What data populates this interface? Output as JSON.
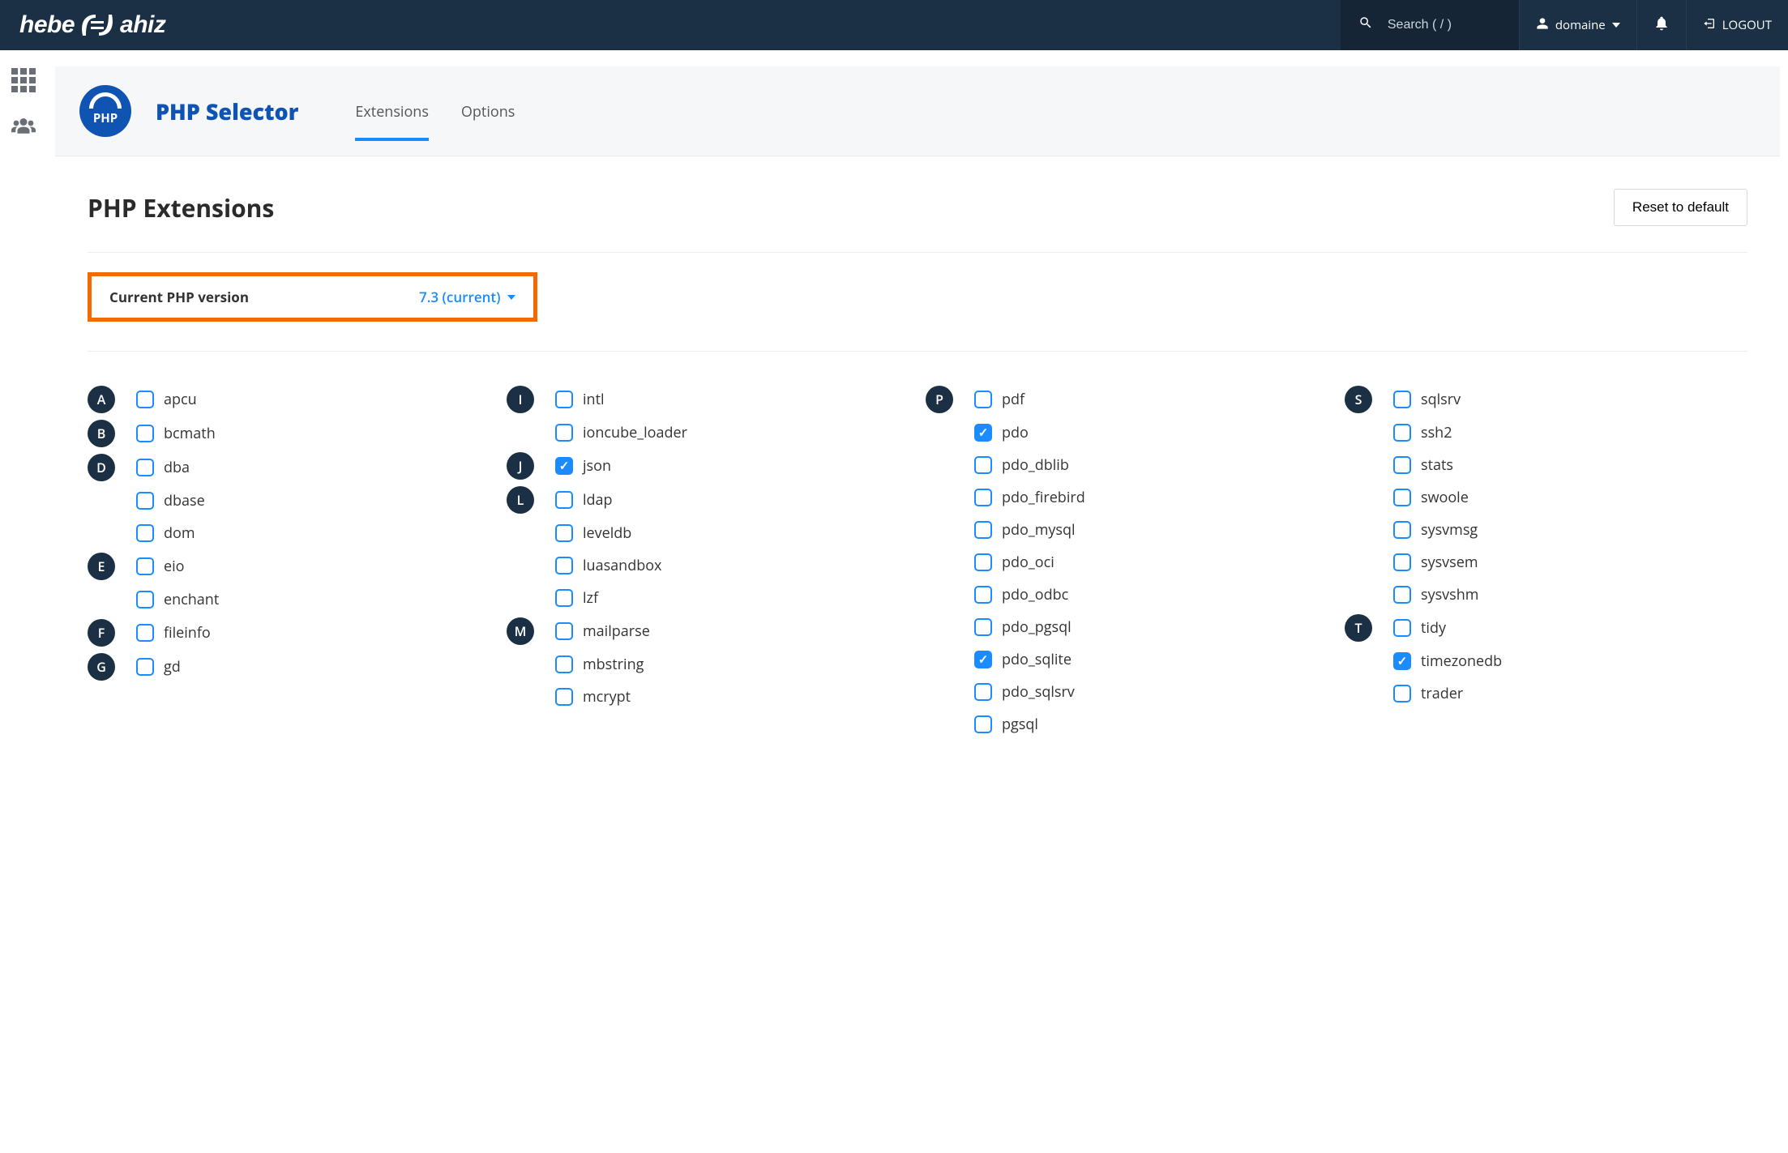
{
  "nav": {
    "brand_left": "hebe",
    "brand_right": "ahiz",
    "search_placeholder": "Search ( / )",
    "user_label": "domaine",
    "logout_label": "LOGOUT"
  },
  "page": {
    "title": "PHP Selector",
    "tabs": {
      "extensions": "Extensions",
      "options": "Options"
    },
    "section_title": "PHP Extensions",
    "reset_button": "Reset to default",
    "version_label": "Current PHP version",
    "version_value": "7.3 (current)"
  },
  "ext_cols": [
    {
      "groups": [
        {
          "letter": "A",
          "items": [
            {
              "name": "apcu",
              "checked": false
            }
          ]
        },
        {
          "letter": "B",
          "items": [
            {
              "name": "bcmath",
              "checked": false
            }
          ]
        },
        {
          "letter": "D",
          "items": [
            {
              "name": "dba",
              "checked": false
            },
            {
              "name": "dbase",
              "checked": false
            },
            {
              "name": "dom",
              "checked": false
            }
          ]
        },
        {
          "letter": "E",
          "items": [
            {
              "name": "eio",
              "checked": false
            },
            {
              "name": "enchant",
              "checked": false
            }
          ]
        },
        {
          "letter": "F",
          "items": [
            {
              "name": "fileinfo",
              "checked": false
            }
          ]
        },
        {
          "letter": "G",
          "items": [
            {
              "name": "gd",
              "checked": false
            }
          ]
        }
      ]
    },
    {
      "groups": [
        {
          "letter": "I",
          "items": [
            {
              "name": "intl",
              "checked": false
            },
            {
              "name": "ioncube_loader",
              "checked": false
            }
          ]
        },
        {
          "letter": "J",
          "items": [
            {
              "name": "json",
              "checked": true
            }
          ]
        },
        {
          "letter": "L",
          "items": [
            {
              "name": "ldap",
              "checked": false
            },
            {
              "name": "leveldb",
              "checked": false
            },
            {
              "name": "luasandbox",
              "checked": false
            },
            {
              "name": "lzf",
              "checked": false
            }
          ]
        },
        {
          "letter": "M",
          "items": [
            {
              "name": "mailparse",
              "checked": false
            },
            {
              "name": "mbstring",
              "checked": false
            },
            {
              "name": "mcrypt",
              "checked": false
            }
          ]
        }
      ]
    },
    {
      "groups": [
        {
          "letter": "P",
          "items": [
            {
              "name": "pdf",
              "checked": false
            },
            {
              "name": "pdo",
              "checked": true
            },
            {
              "name": "pdo_dblib",
              "checked": false
            },
            {
              "name": "pdo_firebird",
              "checked": false
            },
            {
              "name": "pdo_mysql",
              "checked": false
            },
            {
              "name": "pdo_oci",
              "checked": false
            },
            {
              "name": "pdo_odbc",
              "checked": false
            },
            {
              "name": "pdo_pgsql",
              "checked": false
            },
            {
              "name": "pdo_sqlite",
              "checked": true
            },
            {
              "name": "pdo_sqlsrv",
              "checked": false
            },
            {
              "name": "pgsql",
              "checked": false
            }
          ]
        }
      ]
    },
    {
      "groups": [
        {
          "letter": "S",
          "items": [
            {
              "name": "sqlsrv",
              "checked": false
            },
            {
              "name": "ssh2",
              "checked": false
            },
            {
              "name": "stats",
              "checked": false
            },
            {
              "name": "swoole",
              "checked": false
            },
            {
              "name": "sysvmsg",
              "checked": false
            },
            {
              "name": "sysvsem",
              "checked": false
            },
            {
              "name": "sysvshm",
              "checked": false
            }
          ]
        },
        {
          "letter": "T",
          "items": [
            {
              "name": "tidy",
              "checked": false
            },
            {
              "name": "timezonedb",
              "checked": true
            },
            {
              "name": "trader",
              "checked": false
            }
          ]
        }
      ]
    }
  ]
}
